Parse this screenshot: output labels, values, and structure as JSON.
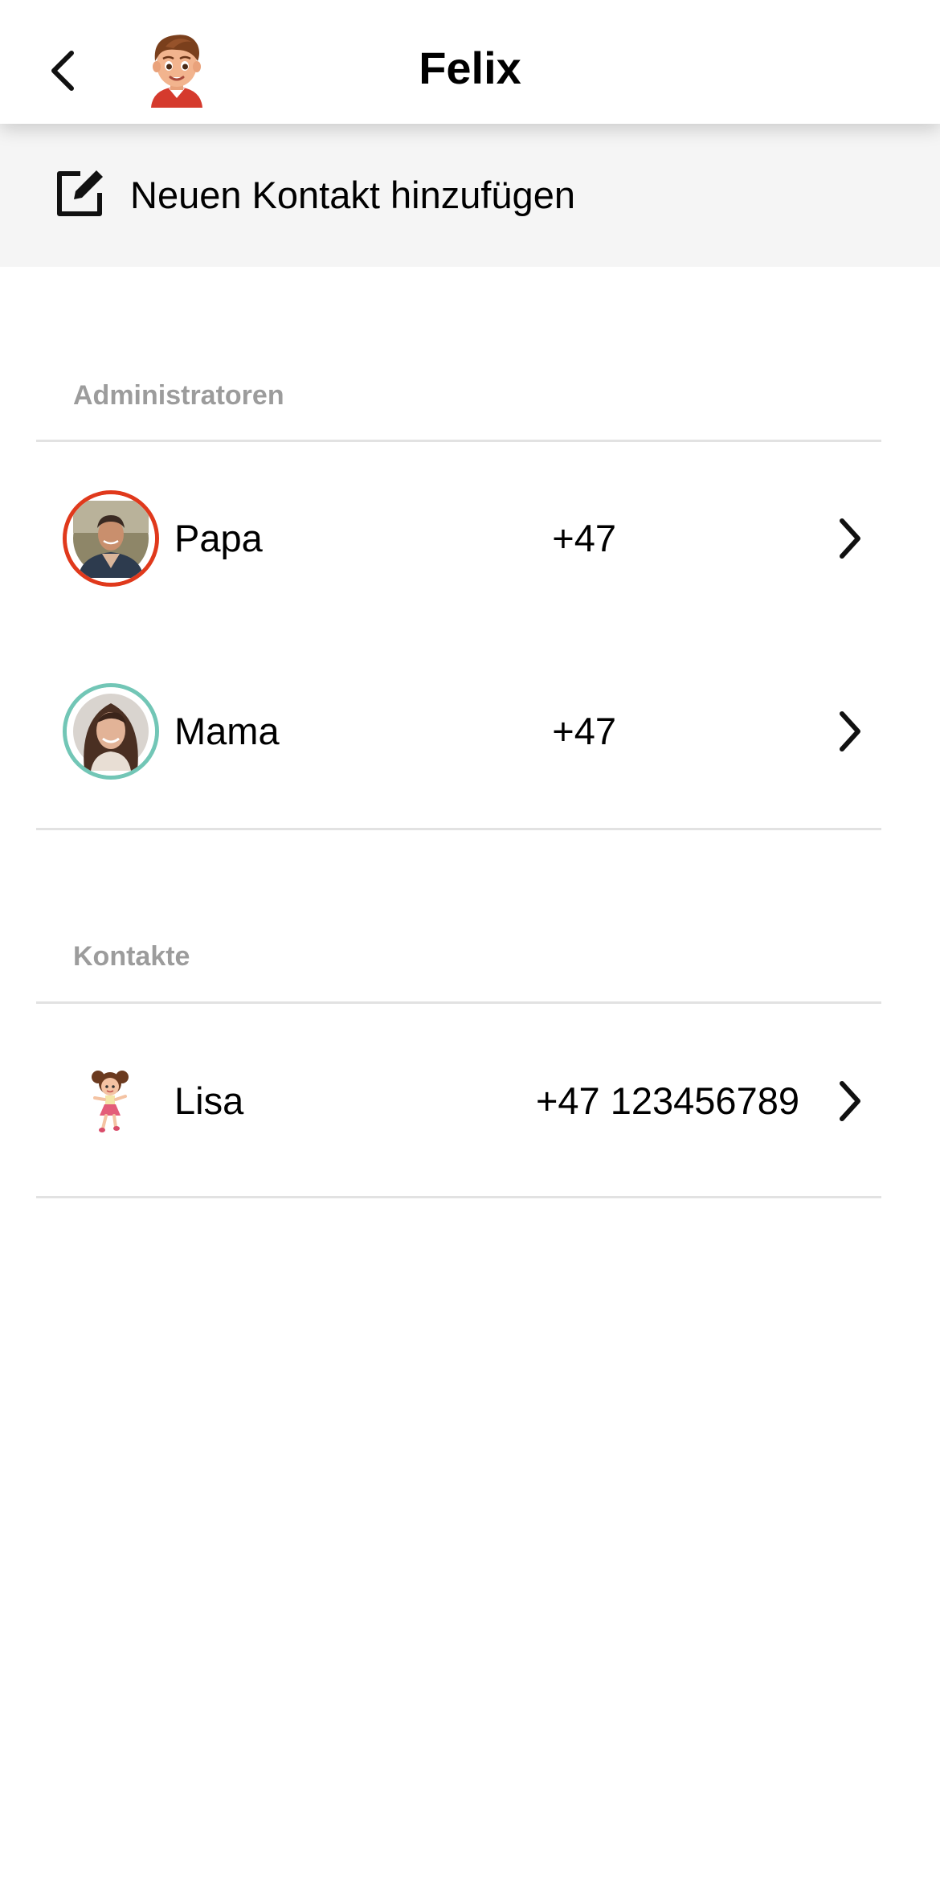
{
  "header": {
    "title": "Felix",
    "back_icon": "chevron-left-icon",
    "avatar_icon": "boy-cartoon-avatar"
  },
  "add_contact": {
    "icon": "edit-square-icon",
    "label": "Neuen Kontakt hinzufügen"
  },
  "sections": {
    "admins": {
      "label": "Administratoren",
      "items": [
        {
          "name": "Papa",
          "phone": "+47",
          "ring_color": "#e0391c"
        },
        {
          "name": "Mama",
          "phone": "+47",
          "ring_color": "#72c6b6"
        }
      ]
    },
    "contacts": {
      "label": "Kontakte",
      "items": [
        {
          "name": "Lisa",
          "phone": "+47 123456789"
        }
      ]
    }
  }
}
